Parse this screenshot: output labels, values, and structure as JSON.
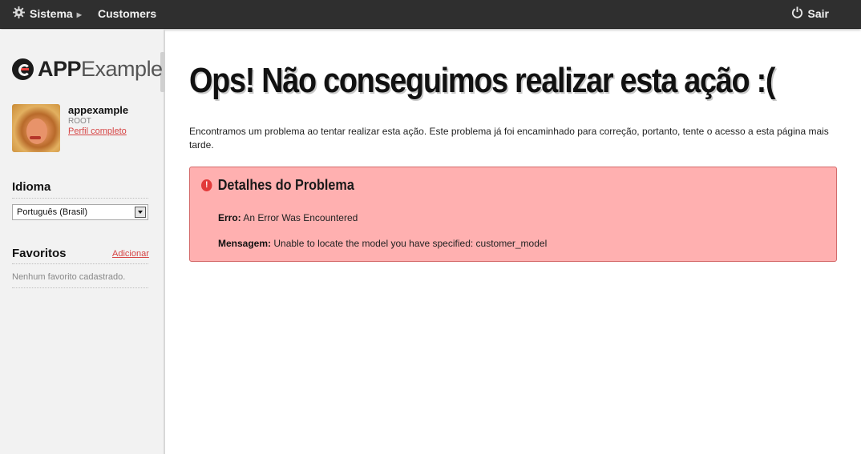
{
  "topbar": {
    "sistema_label": "Sistema",
    "customers_label": "Customers",
    "sair_label": "Sair"
  },
  "sidebar": {
    "logo_bold": "APP",
    "logo_light": "Example",
    "user": {
      "name": "appexample",
      "role": "ROOT",
      "profile_link": "Perfil completo"
    },
    "idioma": {
      "title": "Idioma",
      "selected": "Português (Brasil)"
    },
    "favoritos": {
      "title": "Favoritos",
      "add_link": "Adicionar",
      "empty_text": "Nenhum favorito cadastrado."
    }
  },
  "main": {
    "title": "Ops! Não conseguimos realizar esta ação :(",
    "intro": "Encontramos um problema ao tentar realizar esta ação. Este problema já foi encaminhado para correção, portanto, tente o acesso a esta página mais tarde.",
    "alert": {
      "title": "Detalhes do Problema",
      "erro_label": "Erro:",
      "erro_value": "An Error Was Encountered",
      "mensagem_label": "Mensagem:",
      "mensagem_value": "Unable to locate the model you have specified: customer_model"
    }
  },
  "colors": {
    "topbar_bg": "#2f2f2f",
    "alert_bg": "#ffb0b0",
    "alert_border": "#d46a6a",
    "link": "#d64545"
  }
}
